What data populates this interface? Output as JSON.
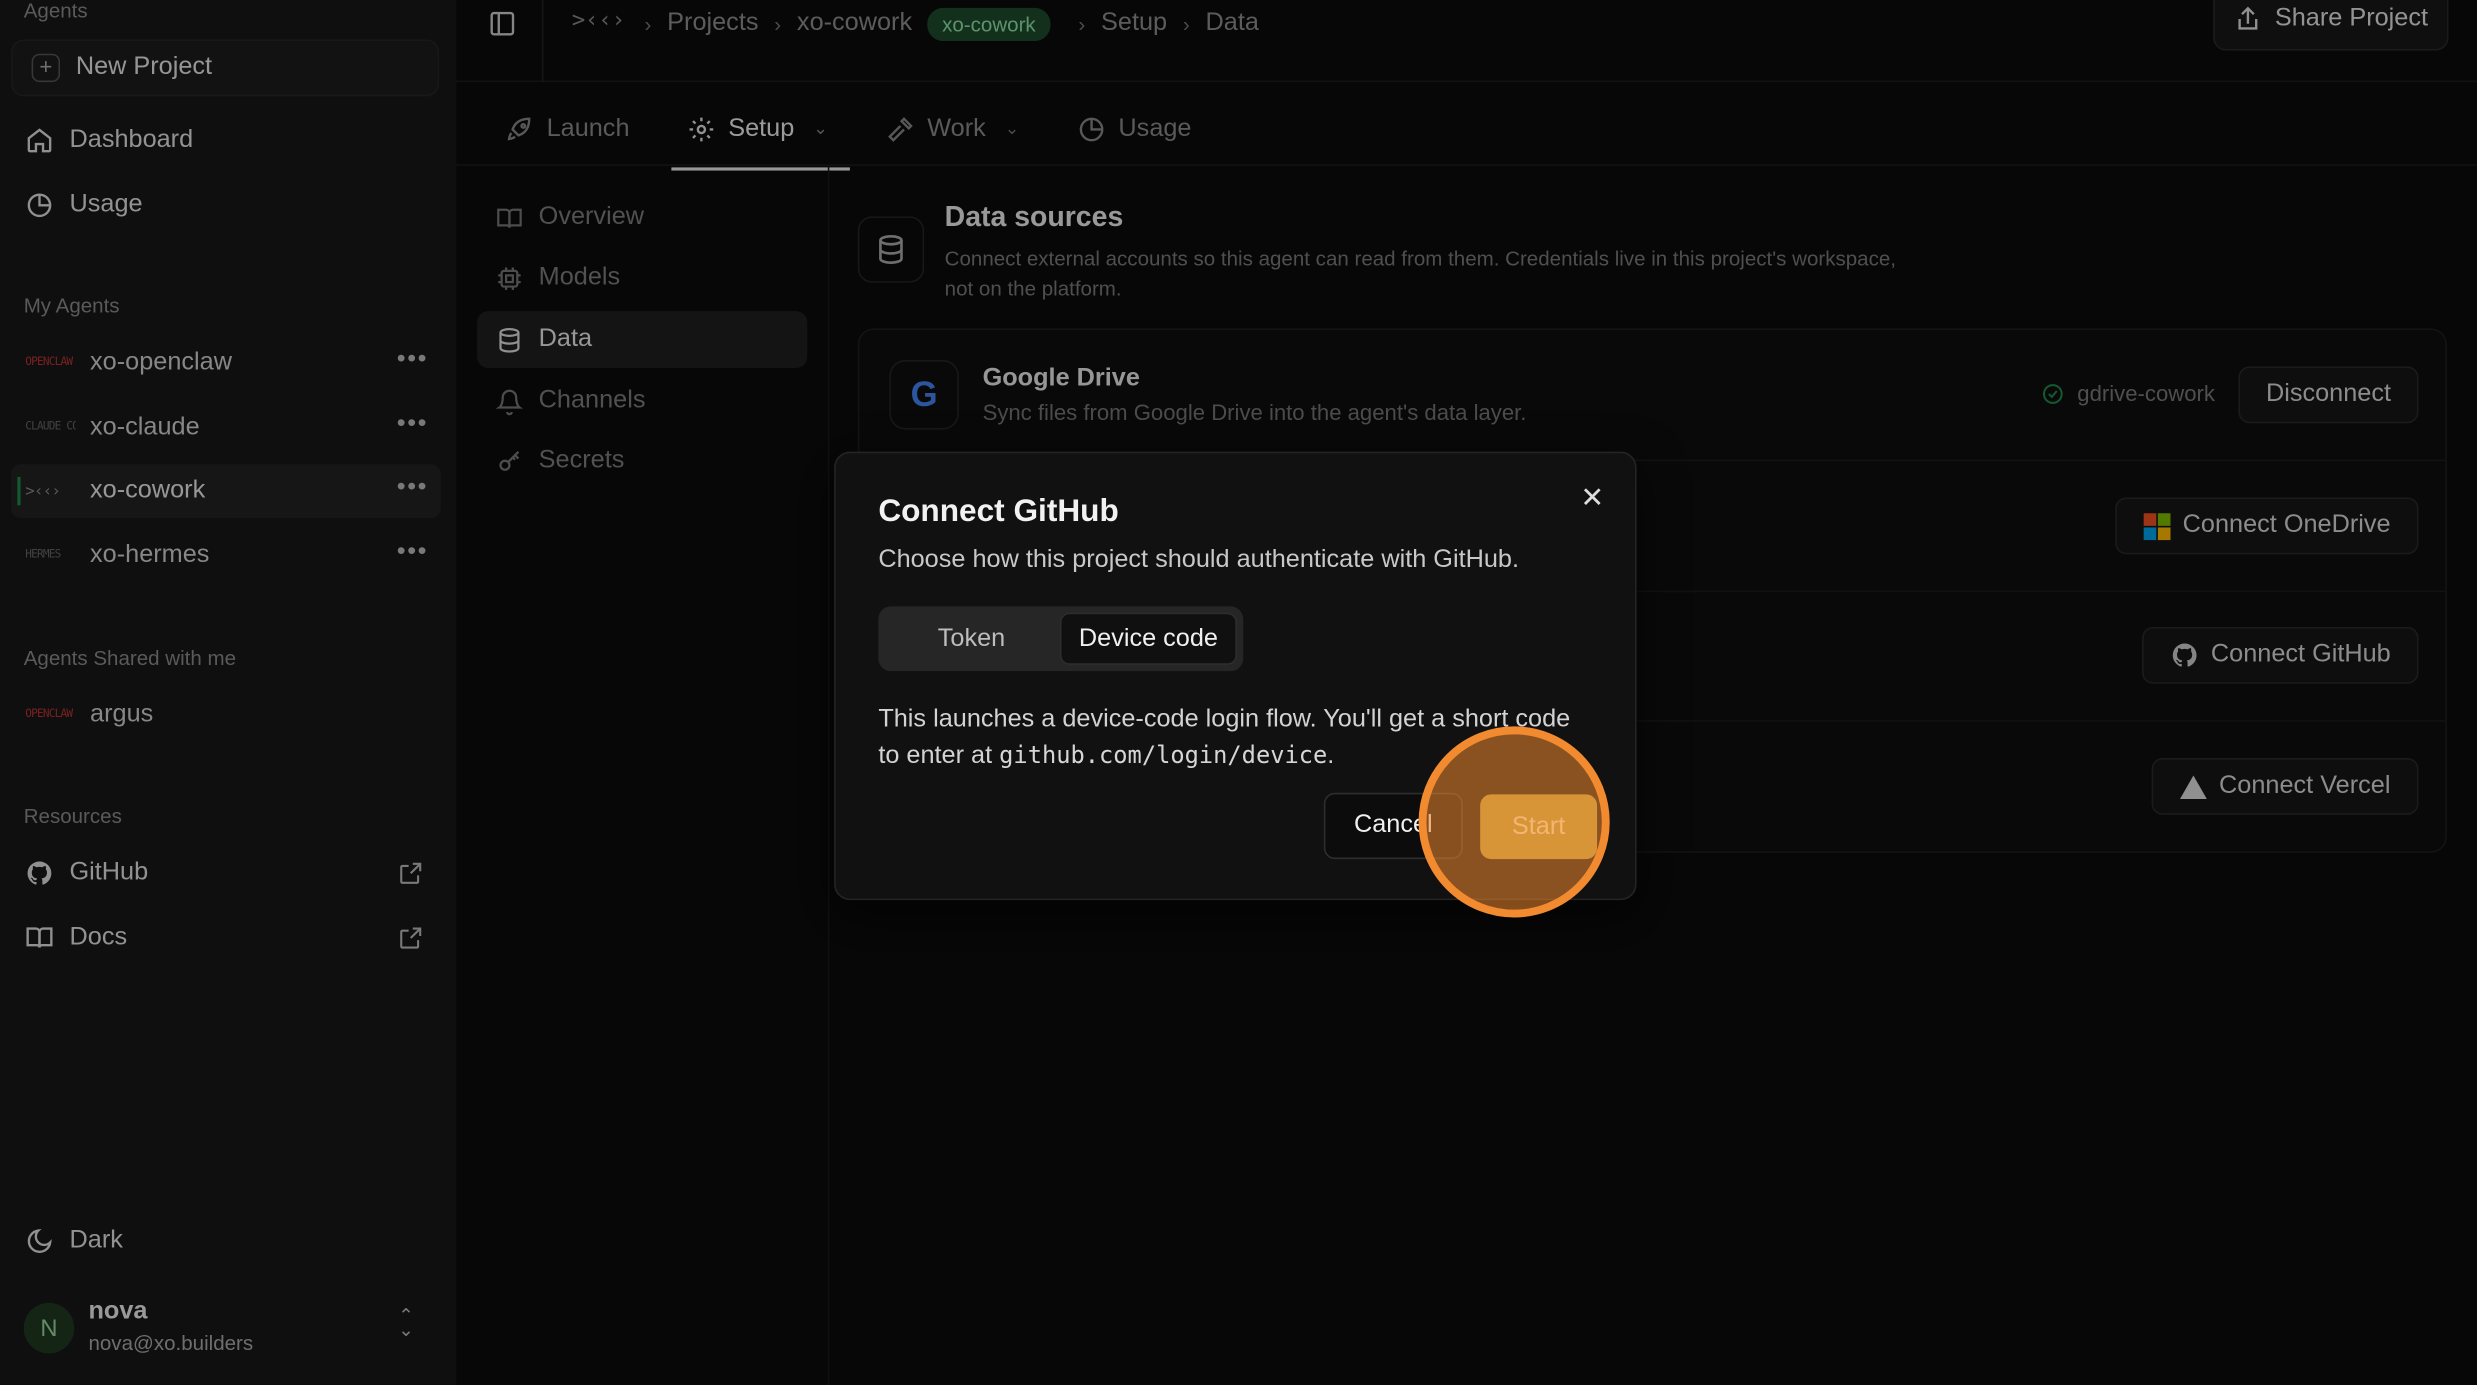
{
  "sidebar": {
    "agents_header": "Agents",
    "new_project": "New Project",
    "nav": [
      {
        "label": "Dashboard"
      },
      {
        "label": "Usage"
      }
    ],
    "my_agents_header": "My Agents",
    "my_agents": [
      {
        "label": "xo-openclaw",
        "logo": "OPENCLAW"
      },
      {
        "label": "xo-claude",
        "logo": "CLAUDE CODE"
      },
      {
        "label": "xo-cowork",
        "logo": ">‹‹›"
      },
      {
        "label": "xo-hermes",
        "logo": "HERMES"
      }
    ],
    "shared_header": "Agents Shared with me",
    "shared_agents": [
      {
        "label": "argus",
        "logo": "OPENCLAW"
      }
    ],
    "resources_header": "Resources",
    "resources": [
      {
        "label": "GitHub"
      },
      {
        "label": "Docs"
      }
    ],
    "theme": "Dark",
    "user": {
      "initial": "N",
      "name": "nova",
      "email": "nova@xo.builders"
    }
  },
  "topbar": {
    "crumbs": [
      "Projects",
      "xo-cowork",
      "Setup",
      "Data"
    ],
    "pill": "xo-cowork",
    "share": "Share Project"
  },
  "tabs": [
    {
      "label": "Launch"
    },
    {
      "label": "Setup"
    },
    {
      "label": "Work"
    },
    {
      "label": "Usage"
    }
  ],
  "subnav": [
    {
      "label": "Overview"
    },
    {
      "label": "Models"
    },
    {
      "label": "Data"
    },
    {
      "label": "Channels"
    },
    {
      "label": "Secrets"
    }
  ],
  "data_sources": {
    "title": "Data sources",
    "description": "Connect external accounts so this agent can read from them. Credentials live in this project's workspace, not on the platform.",
    "google_drive": {
      "title": "Google Drive",
      "description": "Sync files from Google Drive into the agent's data layer.",
      "status": "gdrive-cowork",
      "button": "Disconnect"
    },
    "onedrive_button": "Connect OneDrive",
    "github_button": "Connect GitHub",
    "vercel_button": "Connect Vercel"
  },
  "modal": {
    "title": "Connect GitHub",
    "subtitle": "Choose how this project should authenticate with GitHub.",
    "segments": [
      "Token",
      "Device code"
    ],
    "body_prefix": "This launches a device-code login flow. You'll get a short code to enter at ",
    "body_code": "github.com/login/device",
    "body_suffix": ".",
    "cancel": "Cancel",
    "start": "Start"
  },
  "colors": {
    "accent_green": "#1d4a2c",
    "start_button": "#b8a544",
    "highlight": "#f28a30"
  }
}
